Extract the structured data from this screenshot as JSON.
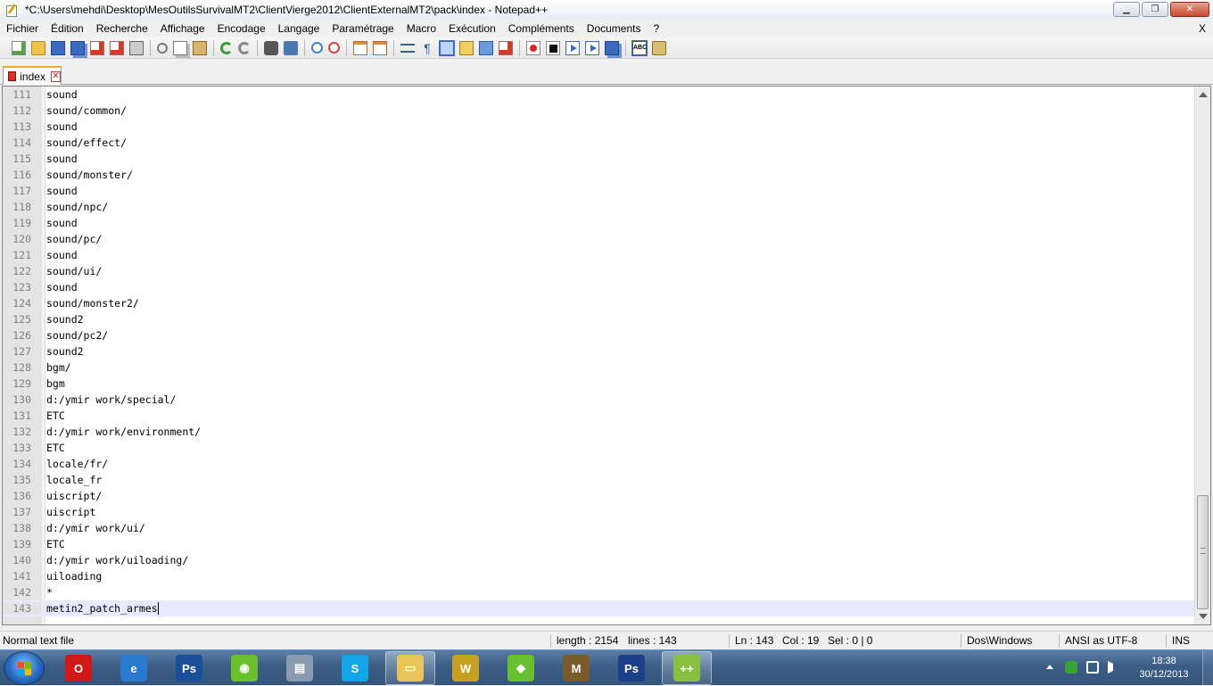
{
  "window": {
    "title": "*C:\\Users\\mehdi\\Desktop\\MesOutilsSurvivalMT2\\ClientVierge2012\\ClientExternalMT2\\pack\\index - Notepad++",
    "minimize_glyph": "▁",
    "restore_glyph": "❐",
    "close_glyph": "✕"
  },
  "menu": {
    "items": [
      "Fichier",
      "Édition",
      "Recherche",
      "Affichage",
      "Encodage",
      "Langage",
      "Paramétrage",
      "Macro",
      "Exécution",
      "Compléments",
      "Documents",
      "?"
    ],
    "close_label": "X"
  },
  "toolbar": {
    "icons": [
      "new-file-icon",
      "open-file-icon",
      "save-icon",
      "save-all-icon",
      "close-icon",
      "close-all-icon",
      "print-icon",
      "cut-icon",
      "copy-icon",
      "paste-icon",
      "undo-icon",
      "redo-icon",
      "find-icon",
      "replace-icon",
      "zoom-in-icon",
      "zoom-out-icon",
      "sync-vertical-icon",
      "sync-horizontal-icon",
      "word-wrap-icon",
      "show-all-chars-icon",
      "indent-guide-icon",
      "fold-icon",
      "document-map-icon",
      "function-list-icon",
      "record-macro-icon",
      "stop-macro-icon",
      "play-macro-icon",
      "run-macro-multiple-icon",
      "save-macro-icon",
      "spell-check-icon",
      "plugin-icon"
    ]
  },
  "tab": {
    "label": "index",
    "close_glyph": "✕"
  },
  "editor": {
    "lines": [
      {
        "n": "111",
        "text": "sound"
      },
      {
        "n": "112",
        "text": "sound/common/"
      },
      {
        "n": "113",
        "text": "sound"
      },
      {
        "n": "114",
        "text": "sound/effect/"
      },
      {
        "n": "115",
        "text": "sound"
      },
      {
        "n": "116",
        "text": "sound/monster/"
      },
      {
        "n": "117",
        "text": "sound"
      },
      {
        "n": "118",
        "text": "sound/npc/"
      },
      {
        "n": "119",
        "text": "sound"
      },
      {
        "n": "120",
        "text": "sound/pc/"
      },
      {
        "n": "121",
        "text": "sound"
      },
      {
        "n": "122",
        "text": "sound/ui/"
      },
      {
        "n": "123",
        "text": "sound"
      },
      {
        "n": "124",
        "text": "sound/monster2/"
      },
      {
        "n": "125",
        "text": "sound2"
      },
      {
        "n": "126",
        "text": "sound/pc2/"
      },
      {
        "n": "127",
        "text": "sound2"
      },
      {
        "n": "128",
        "text": "bgm/"
      },
      {
        "n": "129",
        "text": "bgm"
      },
      {
        "n": "130",
        "text": "d:/ymir work/special/"
      },
      {
        "n": "131",
        "text": "ETC"
      },
      {
        "n": "132",
        "text": "d:/ymir work/environment/"
      },
      {
        "n": "133",
        "text": "ETC"
      },
      {
        "n": "134",
        "text": "locale/fr/"
      },
      {
        "n": "135",
        "text": "locale_fr"
      },
      {
        "n": "136",
        "text": "uiscript/"
      },
      {
        "n": "137",
        "text": "uiscript"
      },
      {
        "n": "138",
        "text": "d:/ymir work/ui/"
      },
      {
        "n": "139",
        "text": "ETC"
      },
      {
        "n": "140",
        "text": "d:/ymir work/uiloading/"
      },
      {
        "n": "141",
        "text": "uiloading"
      },
      {
        "n": "142",
        "text": "*"
      },
      {
        "n": "143",
        "text": "metin2_patch_armes",
        "current": true
      }
    ]
  },
  "status": {
    "file_type": "Normal text file",
    "length": "length : 2154",
    "lines": "lines : 143",
    "ln": "Ln : 143",
    "col": "Col : 19",
    "sel": "Sel : 0 | 0",
    "eol": "Dos\\Windows",
    "encoding": "ANSI as UTF-8",
    "mode": "INS"
  },
  "taskbar": {
    "apps": [
      {
        "name": "opera-icon",
        "glyph": "O",
        "color": "#d01818"
      },
      {
        "name": "internet-explorer-icon",
        "glyph": "e",
        "color": "#2a7ad0"
      },
      {
        "name": "photoshop-setup-icon",
        "glyph": "Ps",
        "color": "#1c4f9a"
      },
      {
        "name": "spotify-icon",
        "glyph": "◉",
        "color": "#6abf2a"
      },
      {
        "name": "device-icon",
        "glyph": "▤",
        "color": "#8a9ab0"
      },
      {
        "name": "skype-icon",
        "glyph": "S",
        "color": "#12a5e8"
      },
      {
        "name": "file-explorer-icon",
        "glyph": "▭",
        "color": "#e8c45a"
      },
      {
        "name": "winamp-icon",
        "glyph": "W",
        "color": "#c8a020"
      },
      {
        "name": "green-app-icon",
        "glyph": "◆",
        "color": "#68c030"
      },
      {
        "name": "metin2-icon",
        "glyph": "M",
        "color": "#7a5a2a"
      },
      {
        "name": "photoshop-icon",
        "glyph": "Ps",
        "color": "#1c3f8a"
      },
      {
        "name": "notepad-plus-plus-icon",
        "glyph": "++",
        "color": "#8ac040"
      }
    ],
    "clock_time": "18:38",
    "clock_date": "30/12/2013"
  },
  "colors": {
    "current_line": "#e8e8ff",
    "gutter": "#e4e4e4",
    "tab_accent": "#f5a623"
  }
}
